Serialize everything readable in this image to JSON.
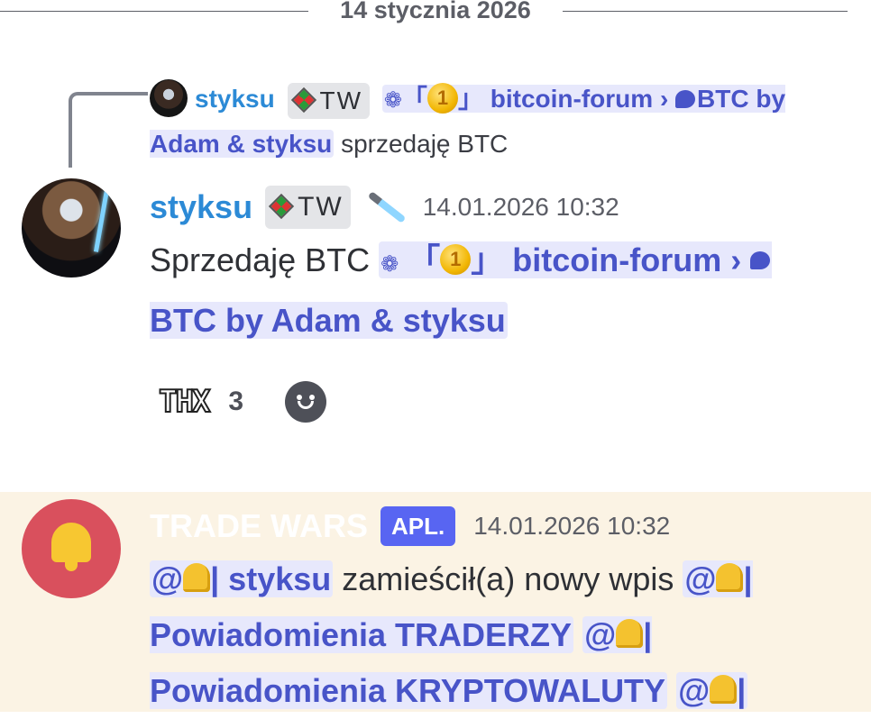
{
  "date_divider": "14 stycznia 2026",
  "reply": {
    "username": "styksu",
    "tag": "TW",
    "forum_bracket_left": "「",
    "coin_digit": "1",
    "forum_bracket_right": "」",
    "forum_name": "bitcoin-forum",
    "chevron": "›",
    "thread_name": "BTC by Adam & styksu",
    "text": "sprzedaję BTC"
  },
  "message": {
    "username": "styksu",
    "tag": "TW",
    "timestamp": "14.01.2026 10:32",
    "text_prefix": "Sprzedaję BTC",
    "forum_bracket_left": "「",
    "coin_digit": "1",
    "forum_bracket_right": "」",
    "forum_name": "bitcoin-forum",
    "chevron": "›",
    "thread_name": "BTC by Adam & styksu",
    "reaction_label": "THX",
    "reaction_count": "3"
  },
  "bot_message": {
    "bot_name": "TRADE WARS",
    "badge": "APL.",
    "timestamp": "14.01.2026 10:32",
    "mention_user": "@",
    "mention_user_name": "| styksu",
    "text": "zamieścił(a) nowy wpis",
    "mention_role1_prefix": "@",
    "mention_role1": "| Powiadomienia TRADERZY",
    "mention_role2_prefix": "@",
    "mention_role2_tail": "|",
    "mention_role2_cont": "Powiadomienia KRYPTOWALUTY",
    "mention_role3_prefix": "@",
    "mention_role3_tail": "|"
  },
  "colors": {
    "username": "#2c8ad6",
    "mention_bg": "#e7e8fc",
    "mention_text": "#4854c8",
    "highlight_bg": "#fbf3e4",
    "badge": "#5865f2",
    "bell_avatar": "#d9505d"
  }
}
